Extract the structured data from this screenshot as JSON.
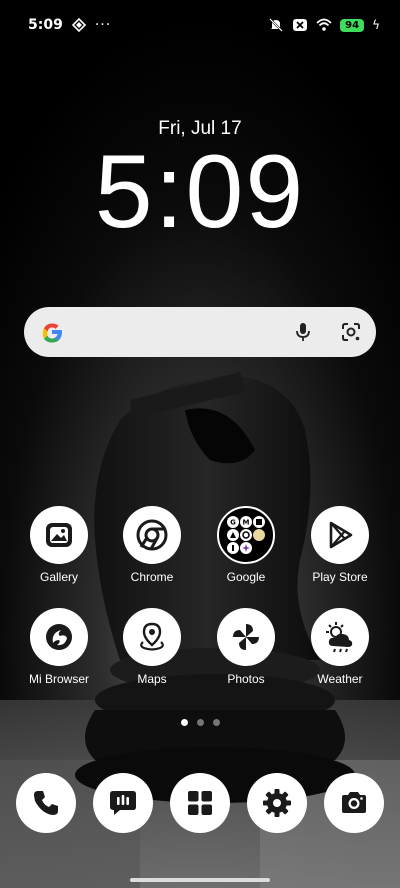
{
  "status_bar": {
    "time": "5:09",
    "battery": "94"
  },
  "lock": {
    "date": "Fri, Jul 17",
    "time": "5:09"
  },
  "search": {
    "icon": "google-g-icon"
  },
  "apps": [
    {
      "label": "Gallery",
      "icon": "gallery-icon"
    },
    {
      "label": "Chrome",
      "icon": "chrome-icon"
    },
    {
      "label": "Google",
      "icon": "google-folder-icon"
    },
    {
      "label": "Play Store",
      "icon": "play-store-icon"
    },
    {
      "label": "Mi Browser",
      "icon": "mi-browser-icon"
    },
    {
      "label": "Maps",
      "icon": "maps-icon"
    },
    {
      "label": "Photos",
      "icon": "photos-icon"
    },
    {
      "label": "Weather",
      "icon": "weather-icon"
    }
  ],
  "dock": [
    {
      "icon": "phone-icon"
    },
    {
      "icon": "messages-icon"
    },
    {
      "icon": "apps-icon"
    },
    {
      "icon": "settings-icon"
    },
    {
      "icon": "camera-icon"
    }
  ],
  "page_indicator": {
    "pages": 3,
    "current": 1
  }
}
